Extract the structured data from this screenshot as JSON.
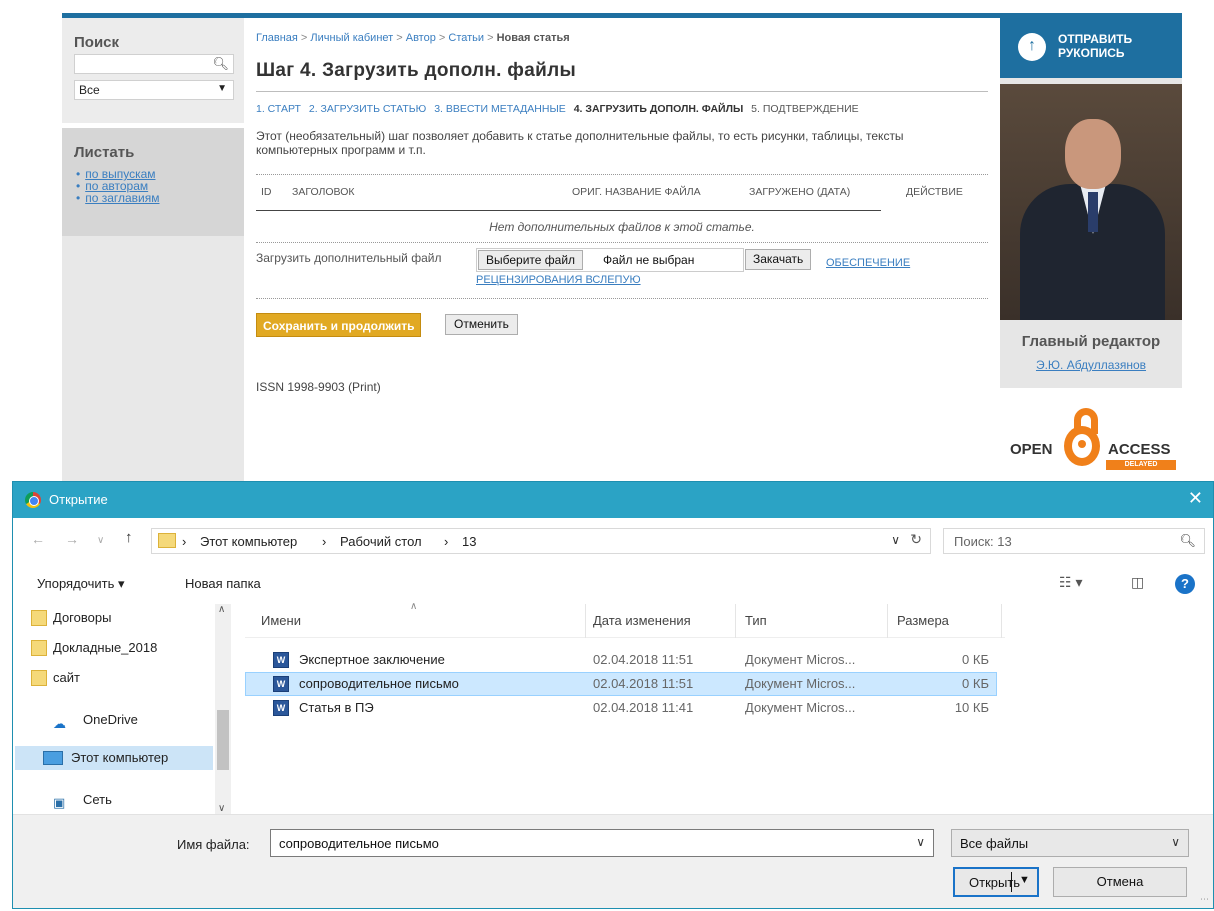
{
  "web": {
    "sidebar_left": {
      "search_title": "Поиск",
      "search_scope": "Все",
      "browse_title": "Листать",
      "browse_links": [
        "по выпускам",
        "по авторам",
        "по заглавиям"
      ]
    },
    "breadcrumb": {
      "home": "Главная",
      "cabinet": "Личный кабинет",
      "author": "Автор",
      "articles": "Статьи",
      "current": "Новая статья",
      "sep": " > "
    },
    "page_title": "Шаг 4. Загрузить дополн. файлы",
    "steps": [
      {
        "label": "1. СТАРТ",
        "state": "link"
      },
      {
        "label": "2. ЗАГРУЗИТЬ СТАТЬЮ",
        "state": "link"
      },
      {
        "label": "3. ВВЕСТИ МЕТАДАННЫЕ",
        "state": "link"
      },
      {
        "label": "4. ЗАГРУЗИТЬ ДОПОЛН. ФАЙЛЫ",
        "state": "current"
      },
      {
        "label": "5. ПОДТВЕРЖДЕНИЕ",
        "state": "plain"
      }
    ],
    "description": "Этот (необязательный) шаг позволяет добавить к статье дополнительные файлы, то есть рисунки, таблицы, тексты компьютерных программ и т.п.",
    "table": {
      "headers": [
        "ID",
        "ЗАГОЛОВОК",
        "ОРИГ. НАЗВАНИЕ ФАЙЛА",
        "ЗАГРУЖЕНО (ДАТА)",
        "ДЕЙСТВИЕ"
      ],
      "empty_message": "Нет дополнительных файлов к этой статье."
    },
    "upload": {
      "label": "Загрузить дополнительный файл",
      "choose_button": "Выберите файл",
      "no_file": "Файл не выбран",
      "upload_button": "Закачать",
      "blind_review_link": "ОБЕСПЕЧЕНИЕ РЕЦЕНЗИРОВАНИЯ ВСЛЕПУЮ"
    },
    "save_button": "Сохранить и продолжить",
    "cancel_button": "Отменить",
    "issn": "ISSN 1998-9903 (Print)",
    "sidebar_right": {
      "submit_label": "ОТПРАВИТЬ РУКОПИСЬ",
      "editor_title": "Главный редактор",
      "editor_name": "Э.Ю. Абдуллазянов",
      "open_word": "OPEN",
      "access_word": "ACCESS",
      "delayed_word": "DELAYED"
    }
  },
  "dialog": {
    "title": "Открытие",
    "path": [
      "Этот компьютер",
      "Рабочий стол",
      "13"
    ],
    "search_placeholder": "Поиск: 13",
    "toolbar": {
      "organize": "Упорядочить ▾",
      "new_folder": "Новая папка"
    },
    "nav_pane": [
      {
        "label": "Договоры",
        "kind": "folder"
      },
      {
        "label": "Докладные_2018",
        "kind": "folder"
      },
      {
        "label": "сайт",
        "kind": "folder"
      },
      {
        "label": "OneDrive",
        "kind": "cloud"
      },
      {
        "label": "Этот компьютер",
        "kind": "pc",
        "selected": true
      },
      {
        "label": "Сеть",
        "kind": "network"
      }
    ],
    "columns": [
      "Имени",
      "Дата изменения",
      "Тип",
      "Размера"
    ],
    "files": [
      {
        "name": "Экспертное заключение",
        "date": "02.04.2018 11:51",
        "type": "Документ Micros...",
        "size": "0 КБ",
        "selected": false
      },
      {
        "name": "сопроводительное письмо",
        "date": "02.04.2018 11:51",
        "type": "Документ Micros...",
        "size": "0 КБ",
        "selected": true
      },
      {
        "name": "Статья в ПЭ",
        "date": "02.04.2018 11:41",
        "type": "Документ Micros...",
        "size": "10 КБ",
        "selected": false
      }
    ],
    "filename_label": "Имя файла:",
    "filename_value": "сопроводительное письмо",
    "filter_value": "Все файлы",
    "open_button": "Открыть",
    "cancel_button": "Отмена"
  },
  "colors": {
    "accent_blue": "#1e6fa0",
    "link_blue": "#3a7ec0",
    "save_orange": "#e1a923",
    "dialog_title": "#2ba3c5",
    "selection": "#cce8ff"
  }
}
